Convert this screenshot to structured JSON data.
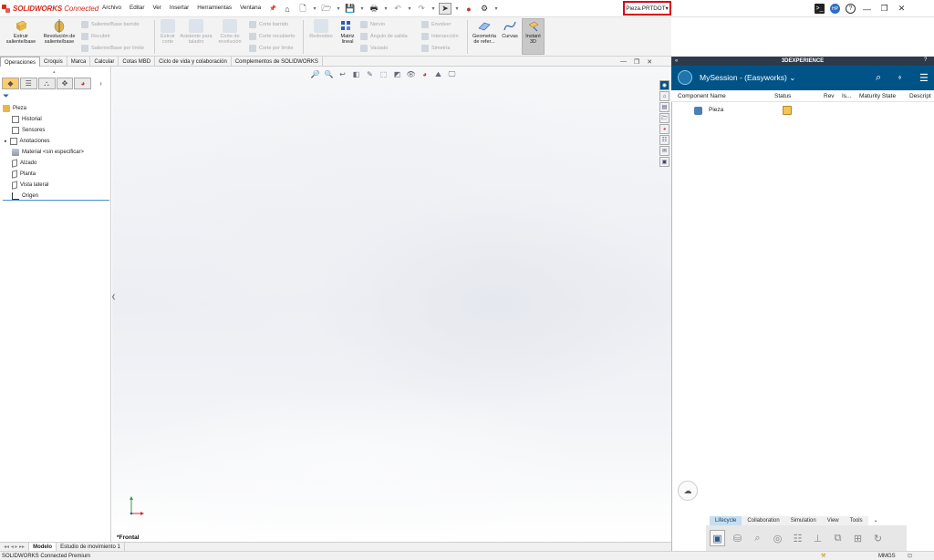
{
  "app": {
    "brand_bold": "SOLIDWORKS",
    "brand_rest": " Connected",
    "document": "Pieza.PRTDOT"
  },
  "menu": [
    "Archivo",
    "Editar",
    "Ver",
    "Insertar",
    "Herramientas",
    "Ventana"
  ],
  "commands": {
    "extrude": "Extruir saliente/base",
    "revolve": "Revolución de saliente/base",
    "sweep_boss": "Saliente/Base barrido",
    "loft_boss": "Recubrir",
    "boundary_boss": "Saliente/Base por límite",
    "extrude_cut": "Extruir corte",
    "hole_wizard": "Asistente para taladro",
    "revolve_cut": "Corte de revolución",
    "sweep_cut": "Corte barrido",
    "loft_cut": "Corte recubierto",
    "boundary_cut": "Corte por límite",
    "fillet": "Redondeo",
    "linear_pattern": "Matriz lineal",
    "rib": "Nervio",
    "draft": "Ángulo de salida",
    "shell": "Vaciado",
    "wrap": "Envolver",
    "intersect": "Intersección",
    "mirror": "Simetría",
    "ref_geometry": "Geometría de refer...",
    "curves": "Curvas",
    "instant3d": "Instant 3D"
  },
  "cmd_tabs": [
    "Operaciones",
    "Croquis",
    "Marca",
    "Calcular",
    "Cotas MBD",
    "Ciclo de vida y colaboración",
    "Complementos de SOLIDWORKS"
  ],
  "tree": {
    "root": "Pieza",
    "items": [
      "Historial",
      "Sensores",
      "Anotaciones",
      "Material <sin especificar>",
      "Alzado",
      "Planta",
      "Vista lateral",
      "Origen"
    ]
  },
  "viewport": {
    "view_name": "*Frontal"
  },
  "model_tabs": [
    "Modelo",
    "Estudio de movimiento 1"
  ],
  "status": {
    "product": "SOLIDWORKS Connected Premium",
    "units": "MMGS"
  },
  "dx": {
    "header": "3DEXPERIENCE",
    "session": "MySession - (Easyworks)",
    "columns": [
      "Component Name",
      "Status",
      "Rev",
      "Is...",
      "Maturity State",
      "Descript"
    ],
    "rows": [
      {
        "name": "Pieza"
      }
    ],
    "bottom_tabs": [
      "Lifecycle",
      "Collaboration",
      "Simulation",
      "View",
      "Tools"
    ]
  },
  "user_initials": "HP",
  "colors": {
    "brand_red": "#d52b1e",
    "dx_blue": "#005386",
    "dx_dark": "#2d3a49",
    "doc_highlight": "#d9001b"
  }
}
